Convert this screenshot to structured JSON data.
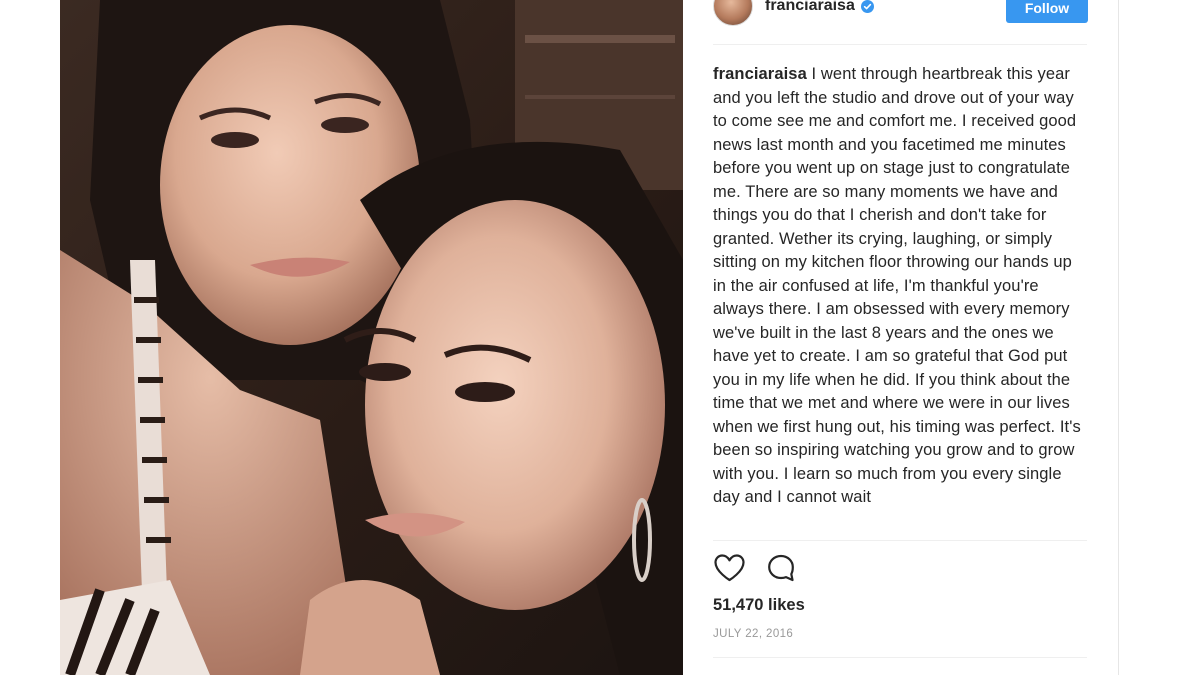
{
  "post": {
    "username": "franciaraisa",
    "follow_label": "Follow",
    "caption_username": "franciaraisa",
    "caption_text": " I went through heartbreak this year and you left the studio and drove out of your way to come see me and comfort me. I received good news last month and you facetimed me minutes before you went up on stage just to congratulate me. There are so many moments we have and things you do that I cherish and don't take for granted. Wether its crying, laughing, or simply sitting on my kitchen floor throwing our hands up in the air confused at life, I'm thankful you're always there. I am obsessed with every memory we've built in the last 8 years and the ones we have yet to create. I am so grateful that God put you in my life when he did. If you think about the time that we met and where we were in our lives when we first hung out, his timing was perfect. It's been so inspiring watching you grow and to grow with you. I learn so much from you every single day and I cannot wait",
    "likes": "51,470 likes",
    "date": "JULY 22, 2016"
  },
  "icons": {
    "verified": "verified-badge-icon",
    "like": "heart-icon",
    "comment": "comment-bubble-icon"
  },
  "colors": {
    "follow_button": "#3897f0",
    "text": "#262626",
    "muted": "#999999",
    "divider": "#efefef"
  }
}
